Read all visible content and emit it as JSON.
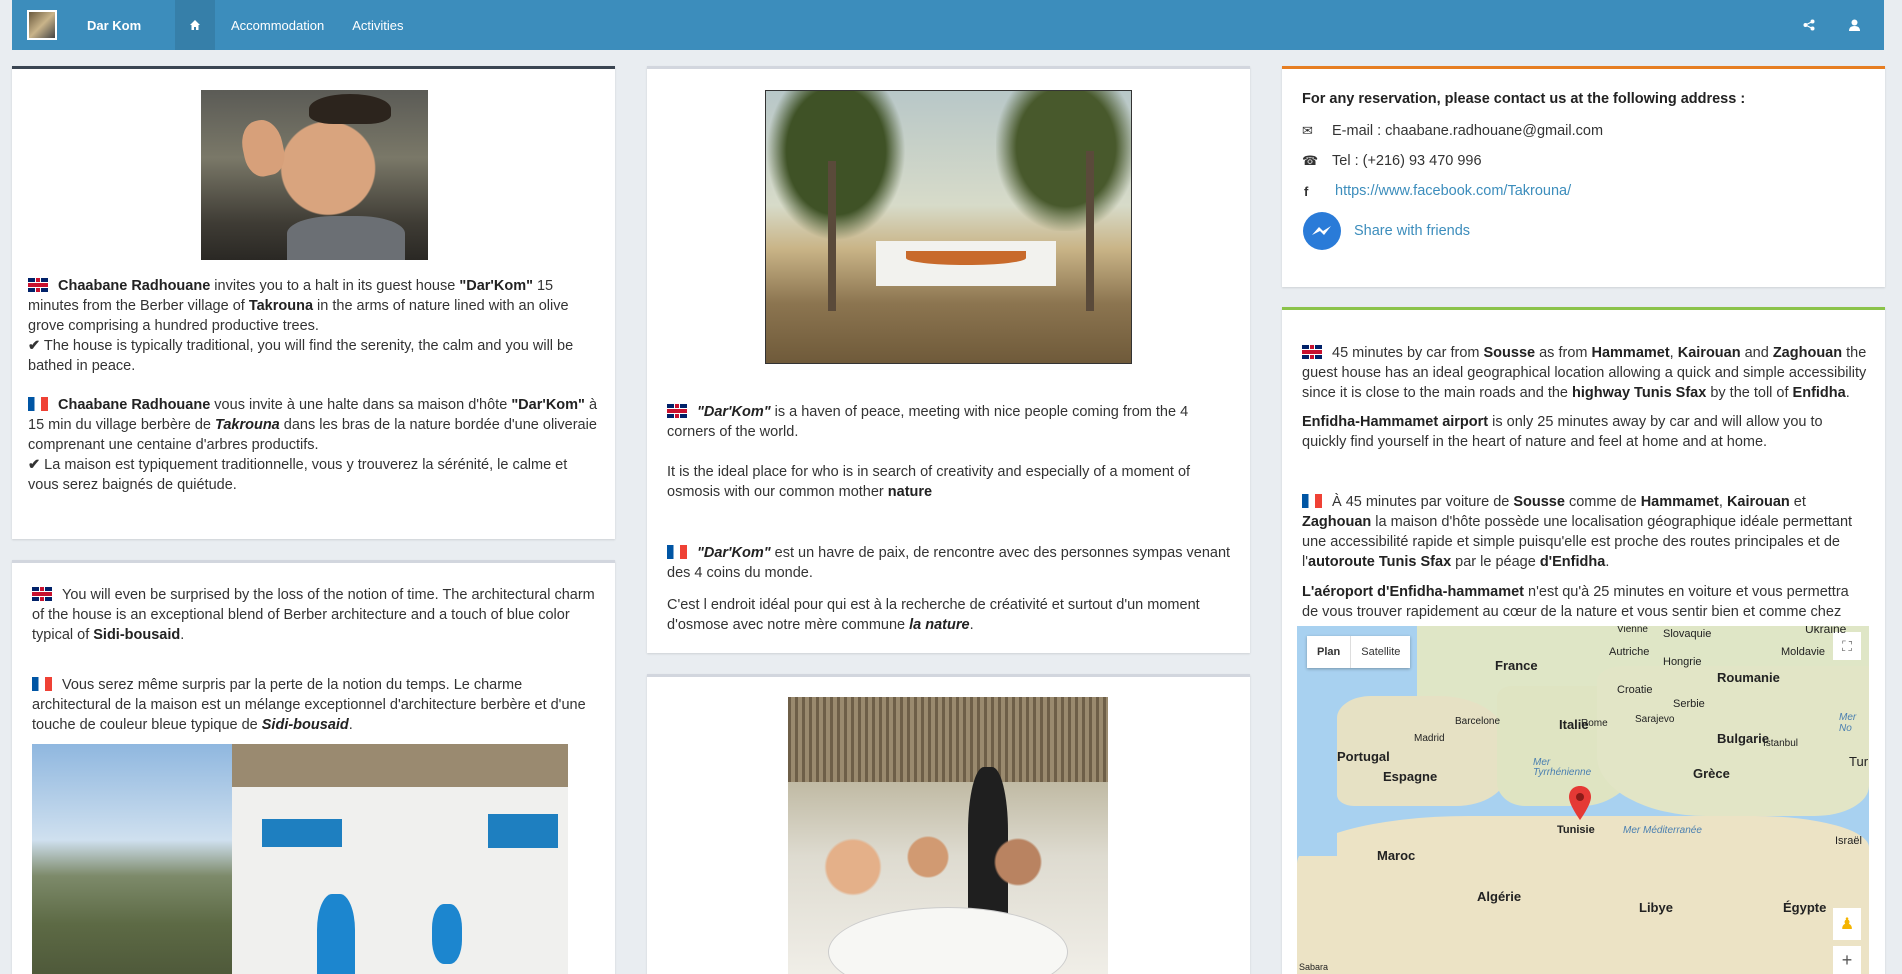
{
  "nav": {
    "brand": "Dar Kom",
    "links": [
      "Accommodation",
      "Activities"
    ],
    "icons": [
      "home-icon",
      "share-icon",
      "user-icon"
    ]
  },
  "col1": {
    "box1": {
      "en": {
        "name": "Chaabane Radhouane",
        "t1": " invites you to a halt in its guest house ",
        "house": "\"Dar'Kom\"",
        "t2": " 15 minutes from the Berber village of ",
        "village": "Takrouna",
        "t3": " in the arms of nature lined with an olive grove comprising a hundred productive trees.",
        "check": " The house is typically traditional, you will find the serenity, the calm and you will be bathed in peace."
      },
      "fr": {
        "name": "Chaabane Radhouane",
        "t1": " vous invite à une halte dans sa maison d'hôte ",
        "house": "\"Dar'Kom\"",
        "t2": " à 15 min du village berbère de ",
        "village": "Takrouna",
        "t3": " dans les bras de la nature bordée d'une oliveraie comprenant une centaine d'arbres productifs.",
        "check": " La maison est typiquement traditionnelle, vous y trouverez la sérénité, le calme et vous serez baignés de quiétude."
      }
    },
    "box2": {
      "en": {
        "t1": "You will even be surprised by the loss of the notion of time. The architectural charm of the house is an exceptional blend of Berber architecture and a touch of blue color typical of ",
        "place": "Sidi-bousaid",
        "t2": "."
      },
      "fr": {
        "t1": "Vous serez même surpris par la perte de la notion du temps. Le charme architectural de la maison est un mélange exceptionnel d'architecture berbère et d'une touche de couleur bleue typique de ",
        "place": "Sidi-bousaid",
        "t2": "."
      }
    }
  },
  "col2": {
    "box1": {
      "en1": {
        "house": "\"Dar'Kom\"",
        "t1": " is a haven of peace, meeting with nice people coming from the 4 corners of the world."
      },
      "en2": {
        "t1": "It is the ideal place for who is in search of creativity and especially of a moment of osmosis with our common mother ",
        "nature": "nature"
      },
      "fr1": {
        "house": "\"Dar'Kom\"",
        "t1": " est un havre de paix, de rencontre avec des personnes sympas venant des 4 coins du monde."
      },
      "fr2": {
        "t1": "C'est l endroit idéal pour qui est à la recherche de créativité et surtout d'un moment d'osmose avec notre mère commune ",
        "nature": "la nature",
        "t2": "."
      }
    }
  },
  "col3": {
    "contact": {
      "heading": "For any reservation, please contact us at the following address :",
      "email": "E-mail : chaabane.radhouane@gmail.com",
      "phone": "Tel : (+216) 93 470 996",
      "facebook": "https://www.facebook.com/Takrouna/",
      "share": "Share with friends"
    },
    "location": {
      "en": {
        "t1": "45 minutes by car from ",
        "c1": "Sousse",
        "t2": " as from ",
        "c2": "Hammamet",
        "t3": ", ",
        "c3": "Kairouan",
        "t4": " and ",
        "c4": "Zaghouan",
        "t5": " the guest house has an ideal geographical location allowing a quick and simple accessibility since it is close to the main roads and the ",
        "hw": "highway Tunis Sfax",
        "t6": " by the toll of  ",
        "toll": "Enfidha",
        "t7": "."
      },
      "en2": {
        "airport": "Enfidha-Hammamet airport",
        "t1": " is only 25 minutes away by car and will allow you to quickly find yourself in the heart of nature and feel at home and at home."
      },
      "fr": {
        "t1": "À 45 minutes par voiture de ",
        "c1": "Sousse",
        "t2": " comme de ",
        "c2": "Hammamet",
        "t3": ", ",
        "c3": "Kairouan",
        "t4": " et ",
        "c4": "Zaghouan",
        "t5": " la maison d'hôte possède une localisation géographique idéale permettant une accessibilité rapide et simple puisqu'elle est proche des routes principales et de l'",
        "hw": "autoroute Tunis Sfax",
        "t6": " par le péage ",
        "toll": "d'Enfidha",
        "t7": "."
      },
      "fr2": {
        "airport": "L'aéroport d'Enfidha-hammamet",
        "t1": " n'est qu'à 25 minutes en voiture et vous permettra de vous trouver rapidement au cœur de la nature et vous sentir bien et comme chez vous."
      }
    },
    "map": {
      "buttons": [
        "Plan",
        "Satellite"
      ],
      "countries": [
        "France",
        "Espagne",
        "Portugal",
        "Italie",
        "Roumanie",
        "Bulgarie",
        "Grèce",
        "Maroc",
        "Algérie",
        "Libye",
        "Égypte",
        "Tunisie",
        "Croatie",
        "Serbie",
        "Hongrie",
        "Autriche",
        "Slovaquie",
        "Moldavie",
        "Ukraine",
        "Israël",
        "Tur"
      ],
      "cities": [
        "Madrid",
        "Barcelone",
        "Rome",
        "Istanbul",
        "Sarajevo",
        "Vienne",
        "Sabara"
      ],
      "seas": [
        "Mer Tyrrhénienne",
        "Mer Méditerranée",
        "Mer No"
      ],
      "zoom": "+"
    }
  },
  "colors": {
    "nav": "#3c8dbc",
    "accent_orange": "#e67e22",
    "accent_green": "#8bc34a",
    "accent_dark": "#3a4552"
  }
}
